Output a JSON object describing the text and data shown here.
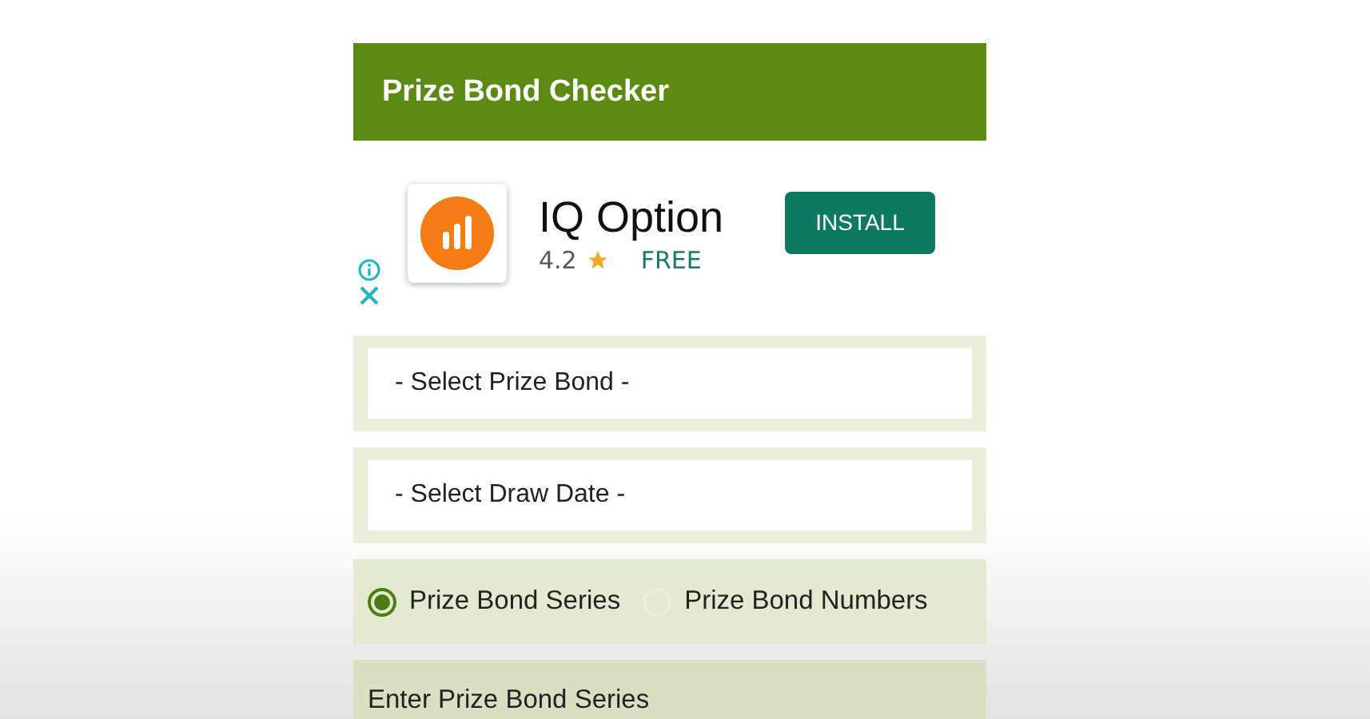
{
  "app_bar": {
    "title": "Prize Bond Checker"
  },
  "ad": {
    "app_name": "IQ Option",
    "rating": "4.2",
    "price": "FREE",
    "button": "INSTALL"
  },
  "selects": [
    {
      "placeholder": "- Select Prize Bond -"
    },
    {
      "placeholder": "- Select Draw Date -"
    }
  ],
  "search_mode": [
    {
      "label": "Prize Bond Series",
      "selected": true
    },
    {
      "label": "Prize Bond Numbers",
      "selected": false
    }
  ],
  "series_section": {
    "label": "Enter Prize Bond Series"
  }
}
